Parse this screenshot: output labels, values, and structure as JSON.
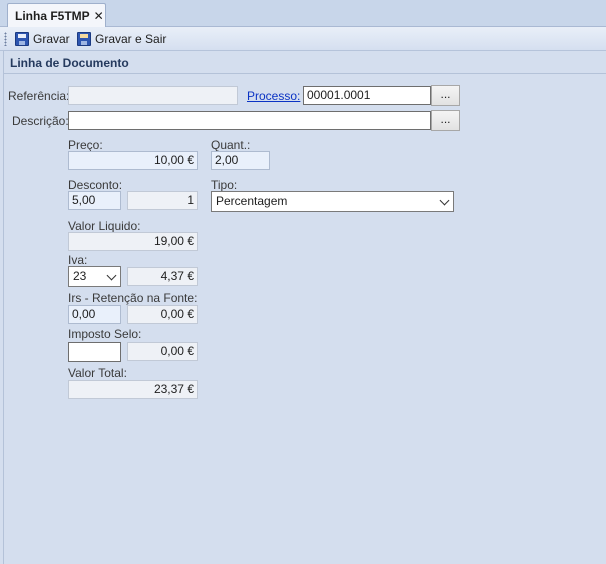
{
  "tab": {
    "title": "Linha F5TMP",
    "close_glyph": "✕"
  },
  "toolbar": {
    "save_label": "Gravar",
    "save_exit_label": "Gravar e Sair"
  },
  "section": {
    "title": "Linha de Documento"
  },
  "form": {
    "referencia": {
      "label": "Referência:",
      "value": ""
    },
    "processo": {
      "label": "Processo:",
      "value": "00001.0001"
    },
    "descricao": {
      "label": "Descrição:",
      "value": ""
    },
    "ellipsis": "...",
    "preco": {
      "label": "Preço:",
      "value": "10,00 €"
    },
    "quant": {
      "label": "Quant.:",
      "value": "2,00"
    },
    "desconto": {
      "label": "Desconto:",
      "value": "5,00",
      "value2": "1"
    },
    "tipo": {
      "label": "Tipo:",
      "selected": "Percentagem"
    },
    "valor_liquido": {
      "label": "Valor Liquido:",
      "value": "19,00 €"
    },
    "iva": {
      "label": "Iva:",
      "selected": "23",
      "value": "4,37 €"
    },
    "irs": {
      "label": "Irs - Retenção na Fonte:",
      "value": "0,00",
      "value2": "0,00 €"
    },
    "imposto_selo": {
      "label": "Imposto Selo:",
      "value": "",
      "value2": "0,00 €"
    },
    "valor_total": {
      "label": "Valor Total:",
      "value": "23,37 €"
    }
  }
}
